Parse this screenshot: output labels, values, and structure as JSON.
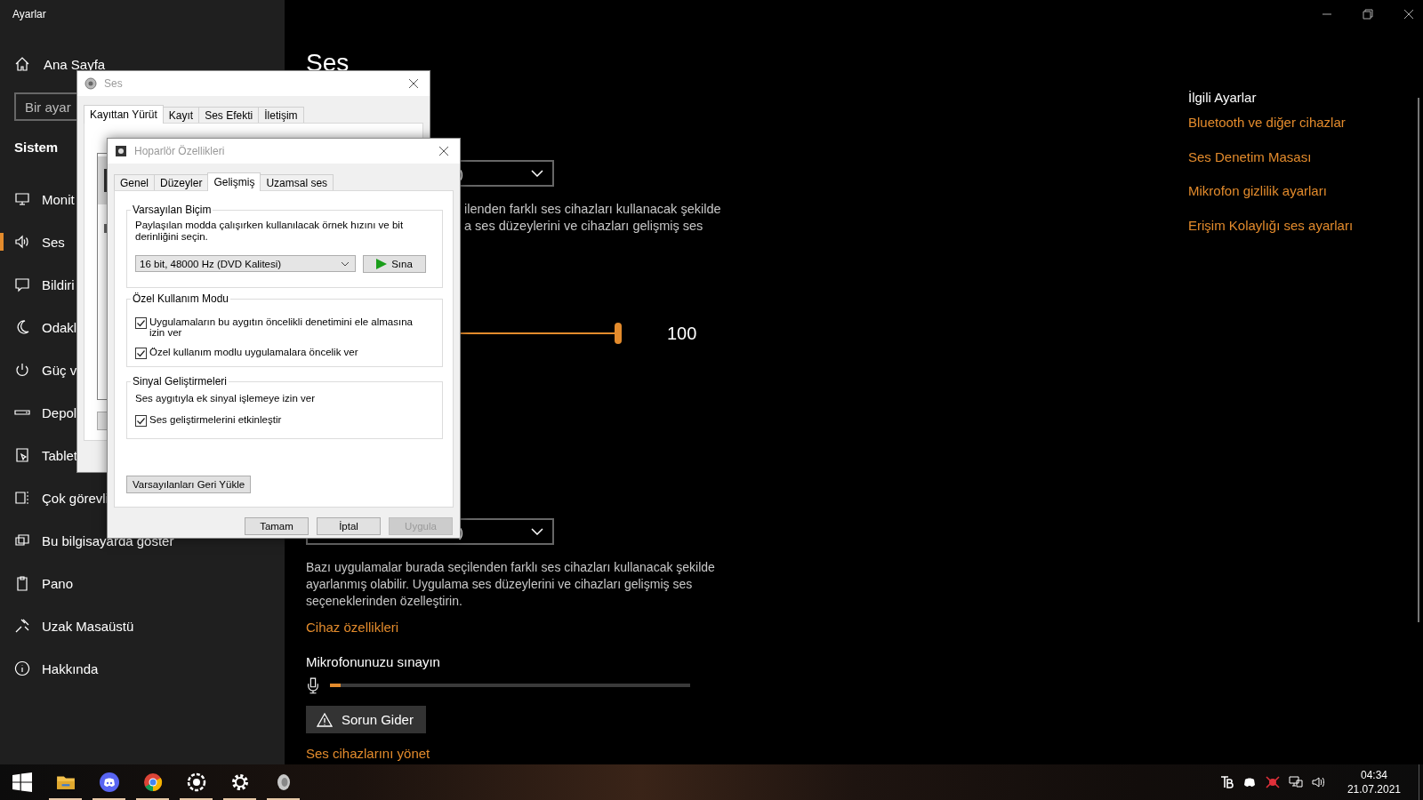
{
  "settings": {
    "title": "Ayarlar",
    "home": "Ana Sayfa",
    "search": {
      "placeholder": "Bir ayar"
    },
    "section": "Sistem",
    "nav": [
      {
        "label": "Monit",
        "selected": false
      },
      {
        "label": "Ses",
        "selected": true
      },
      {
        "label": "Bildiri",
        "selected": false
      },
      {
        "label": "Odakl",
        "selected": false
      },
      {
        "label": "Güç v",
        "selected": false
      },
      {
        "label": "Depol",
        "selected": false
      },
      {
        "label": "Tablet",
        "selected": false
      },
      {
        "label": "Çok görevli",
        "selected": false
      },
      {
        "label": "Bu bilgisayarda göster",
        "selected": false
      },
      {
        "label": "Pano",
        "selected": false
      },
      {
        "label": "Uzak Masaüstü",
        "selected": false
      },
      {
        "label": "Hakkında",
        "selected": false
      }
    ],
    "page_title": "Ses",
    "output_device": {
      "value": ")"
    },
    "output_note_lines": [
      "ilenden farklı ses cihazları kullanacak şekilde",
      "a ses düzeylerini ve cihazları gelişmiş ses"
    ],
    "volume": {
      "level": 1,
      "reading": "100"
    },
    "input_device": {
      "value": ")"
    },
    "input_note": "Bazı uygulamalar burada seçilenden farklı ses cihazları kullanacak şekilde ayarlanmış olabilir. Uygulama ses düzeylerini ve cihazları gelişmiş ses seçeneklerinden özelleştirin.",
    "device_properties_link": "Cihaz özellikleri",
    "mic_test": {
      "label": "Mikrofonunuzu sınayın",
      "level": 0.03
    },
    "troubleshoot_button": "Sorun Gider",
    "manage_link": "Ses cihazlarını yönet",
    "related": {
      "title": "İlgili Ayarlar",
      "links": [
        "Bluetooth ve diğer cihazlar",
        "Ses Denetim Masası",
        "Mikrofon gizlilik ayarları",
        "Erişim Kolaylığı ses ayarları"
      ]
    }
  },
  "sound_dialog": {
    "title": "Ses",
    "tabs": [
      {
        "label": "Kayıttan Yürüt",
        "selected": true
      },
      {
        "label": "Kayıt",
        "selected": false
      },
      {
        "label": "Ses Efekti",
        "selected": false
      },
      {
        "label": "İletişim",
        "selected": false
      }
    ]
  },
  "speaker_dialog": {
    "title": "Hoparlör Özellikleri",
    "tabs": [
      {
        "label": "Genel",
        "selected": false
      },
      {
        "label": "Düzeyler",
        "selected": false
      },
      {
        "label": "Gelişmiş",
        "selected": true
      },
      {
        "label": "Uzamsal ses",
        "selected": false
      }
    ],
    "default_format": {
      "title": "Varsayılan Biçim",
      "description": "Paylaşılan modda çalışırken kullanılacak örnek hızını ve bit derinliğini seçin.",
      "value": "16 bit, 48000 Hz (DVD Kalitesi)",
      "test_button": "Sına"
    },
    "exclusive_mode": {
      "title": "Özel Kullanım Modu",
      "options": [
        {
          "label": "Uygulamaların bu aygıtın öncelikli denetimini ele almasına izin ver",
          "checked": true
        },
        {
          "label": "Özel kullanım modlu uygulamalara öncelik ver",
          "checked": true
        }
      ]
    },
    "enhancements": {
      "title": "Sinyal Geliştirmeleri",
      "description": "Ses aygıtıyla ek sinyal işlemeye izin ver",
      "options": [
        {
          "label": "Ses geliştirmelerini etkinleştir",
          "checked": true
        }
      ]
    },
    "restore_button": "Varsayılanları Geri Yükle",
    "buttons": [
      {
        "label": "Tamam",
        "disabled": false
      },
      {
        "label": "İptal",
        "disabled": false
      },
      {
        "label": "Uygula",
        "disabled": true
      }
    ]
  },
  "taskbar": {
    "apps": [
      {
        "running": false
      },
      {
        "running": true
      },
      {
        "running": true
      },
      {
        "running": true
      },
      {
        "running": true
      },
      {
        "running": true
      },
      {
        "running": true
      }
    ],
    "time": "04:34",
    "date": "21.07.2021"
  }
}
